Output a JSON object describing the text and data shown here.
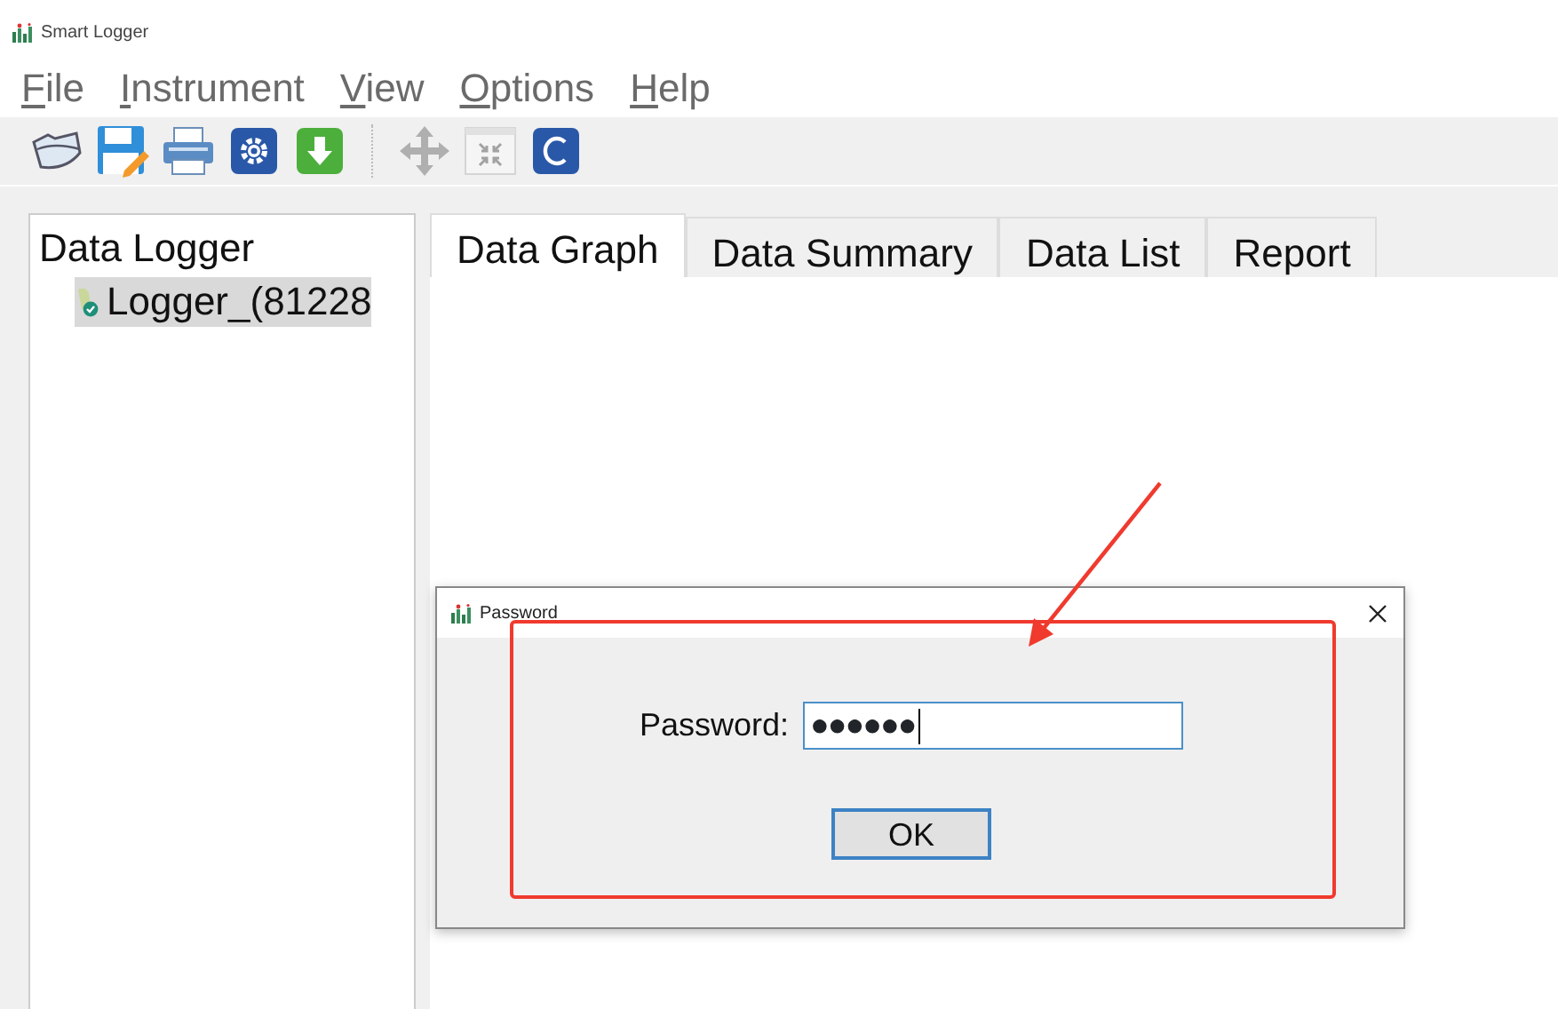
{
  "window": {
    "title": "Smart Logger"
  },
  "menu": [
    {
      "label": "File",
      "mnemonic_underlined": true
    },
    {
      "label": "Instrument",
      "mnemonic_underlined": true
    },
    {
      "label": "View",
      "mnemonic_underlined": true
    },
    {
      "label": "Options",
      "mnemonic_underlined": true
    },
    {
      "label": "Help",
      "mnemonic_underlined": true
    }
  ],
  "toolbar": [
    {
      "kind": "open"
    },
    {
      "kind": "save"
    },
    {
      "kind": "print"
    },
    {
      "kind": "settings"
    },
    {
      "kind": "download"
    },
    {
      "kind": "separator"
    },
    {
      "kind": "move",
      "disabled": true
    },
    {
      "kind": "fit",
      "disabled": true
    },
    {
      "kind": "clear"
    }
  ],
  "sidebar": {
    "title": "Data Logger",
    "items": [
      {
        "label": "Logger_(81228",
        "selected": true
      }
    ]
  },
  "tabs": [
    {
      "label": "Data Graph",
      "selected": true
    },
    {
      "label": "Data Summary",
      "selected": false
    },
    {
      "label": "Data List",
      "selected": false
    },
    {
      "label": "Report",
      "selected": false
    }
  ],
  "dialog": {
    "title": "Password",
    "field_label": "Password:",
    "value": "●●●●●●",
    "button": "OK"
  }
}
